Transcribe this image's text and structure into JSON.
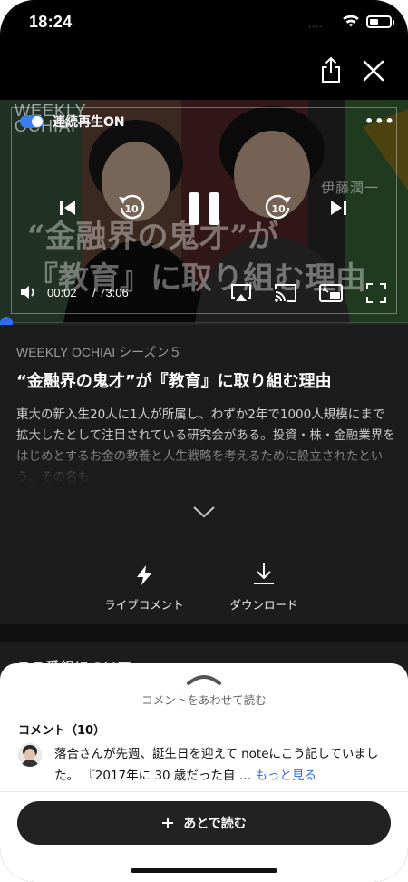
{
  "status": {
    "time": "18:24",
    "signal": "....",
    "icons": [
      "wifi-icon",
      "battery-icon"
    ]
  },
  "top": {
    "icons": [
      "share-icon",
      "close-icon"
    ]
  },
  "player": {
    "autoplay_label": "連続再生ON",
    "autoplay_on": true,
    "more": "•••",
    "brand_watermark": "WEEKLY\nOCHIAI",
    "headline_watermark": "“金融界の鬼才”が\n『教育』に取り組む理由",
    "name_watermark": "伊藤潤一",
    "current_time": "00:02",
    "duration": "/ 73:06",
    "progress_fraction": 0.0005,
    "accent_color": "#2c6ef2",
    "controls": [
      "previous-icon",
      "rewind-10-icon",
      "pause-icon",
      "forward-10-icon",
      "next-icon",
      "volume-icon",
      "airplay-icon",
      "cast-icon",
      "pip-icon",
      "fullscreen-icon"
    ]
  },
  "episode": {
    "series": "WEEKLY OCHIAI シーズン５",
    "title": "“金融界の鬼才”が『教育』に取り組む理由",
    "description": "東大の新入生20人に1人が所属し、わずか2年で1000人規模にまで拡大したとして注目されている研究会がある。投資・株・金融業界をはじめとするお金の教養と人生戦略を考えるために設立されたという、その名も…"
  },
  "actions": {
    "live_comment": "ライブコメント",
    "download": "ダウンロード"
  },
  "about": {
    "title": "この番組について"
  },
  "comments": {
    "hint": "コメントをあわせて読む",
    "header": "コメント（10）",
    "first_text": "落合さんが先週、誕生日を迎えて noteにこう記していました。 『2017年に 30 歳だった自 … ",
    "more_link": "もっと見る"
  },
  "cta": {
    "label": "あとで読む"
  }
}
